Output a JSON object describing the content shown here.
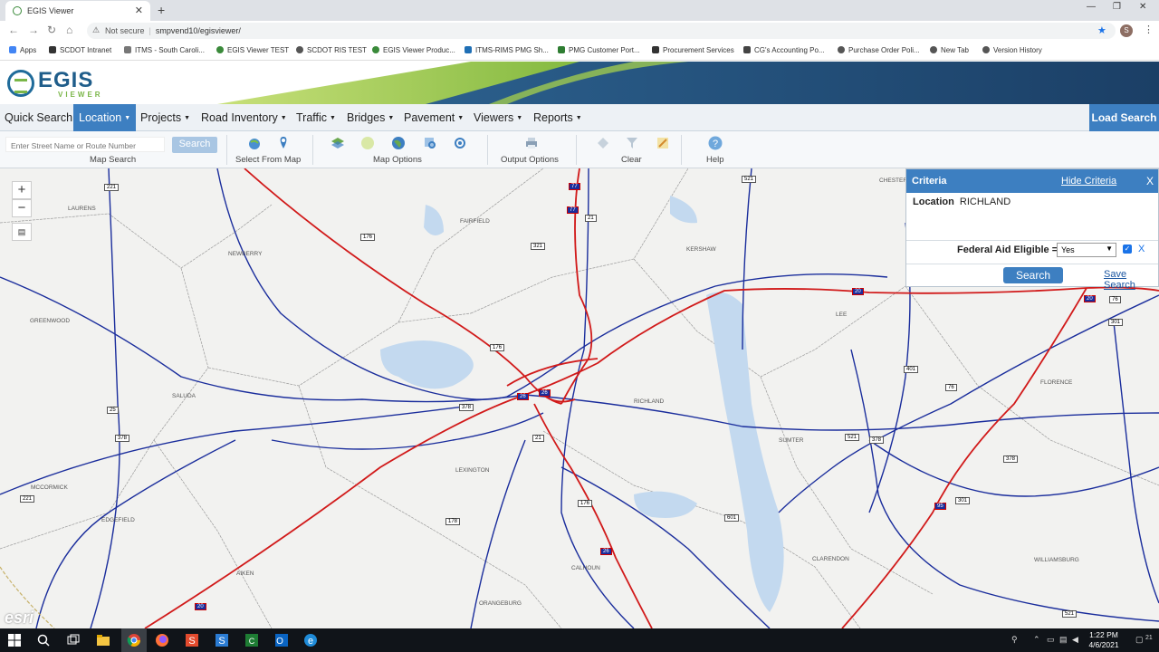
{
  "browser": {
    "tab_title": "EGIS Viewer",
    "tab_close": "✕",
    "new_tab": "+",
    "security": "Not secure",
    "url": "smpvend10/egisviewer/",
    "window_controls": [
      "—",
      "❐",
      "✕"
    ],
    "avatar_letter": "S",
    "bookmarks": [
      "Apps",
      "SCDOT Intranet",
      "ITMS - South Caroli...",
      "EGIS Viewer TEST",
      "SCDOT RIS TEST",
      "EGIS Viewer Produc...",
      "ITMS-RIMS PMG Sh...",
      "PMG Customer Port...",
      "Procurement Services",
      "CG's Accounting Po...",
      "Purchase Order Poli...",
      "New Tab",
      "Version History"
    ]
  },
  "app": {
    "logo_text": "EGIS",
    "logo_sub": "VIEWER",
    "menu": [
      {
        "label": "Quick Search",
        "dropdown": false
      },
      {
        "label": "Location",
        "dropdown": true,
        "active": true
      },
      {
        "label": "Projects",
        "dropdown": true
      },
      {
        "label": "Road Inventory",
        "dropdown": true
      },
      {
        "label": "Traffic",
        "dropdown": true
      },
      {
        "label": "Bridges",
        "dropdown": true
      },
      {
        "label": "Pavement",
        "dropdown": true
      },
      {
        "label": "Viewers",
        "dropdown": true
      },
      {
        "label": "Reports",
        "dropdown": true
      }
    ],
    "load_search": "Load Search",
    "accent_color": "#3d7fc1"
  },
  "toolbar": {
    "search_placeholder": "Enter Street Name or Route Number",
    "search_button": "Search",
    "groups": [
      "Map Search",
      "Select From Map",
      "Map Options",
      "Output Options",
      "Clear",
      "Help"
    ]
  },
  "map": {
    "zoom_in": "+",
    "zoom_out": "−",
    "attribution": "esri",
    "places": [
      "LAURENS",
      "NEWBERRY",
      "GREENWOOD",
      "SALUDA",
      "FAIRFIELD",
      "KERSHAW",
      "CHESTER",
      "LEE",
      "RICHLAND",
      "SUMTER",
      "LEXINGTON",
      "MCCORMICK",
      "EDGEFIELD",
      "AIKEN",
      "CALHOUN",
      "ORANGEBURG",
      "CLARENDON",
      "FLORENCE",
      "WILLIAMSBURG"
    ],
    "shields": [
      "221",
      "176",
      "77",
      "21",
      "321",
      "521",
      "76",
      "301",
      "401",
      "20",
      "26",
      "378",
      "25",
      "601",
      "95",
      "178",
      "1"
    ]
  },
  "criteria": {
    "title": "Criteria",
    "hide": "Hide Criteria",
    "close": "X",
    "location_label": "Location",
    "location_value": "RICHLAND",
    "federal_label": "Federal Aid Eligible =",
    "federal_value": "Yes",
    "remove": "X",
    "search": "Search",
    "save_search": "Save Search"
  },
  "taskbar": {
    "time": "1:22 PM",
    "date": "4/6/2021",
    "notifications": "21"
  }
}
